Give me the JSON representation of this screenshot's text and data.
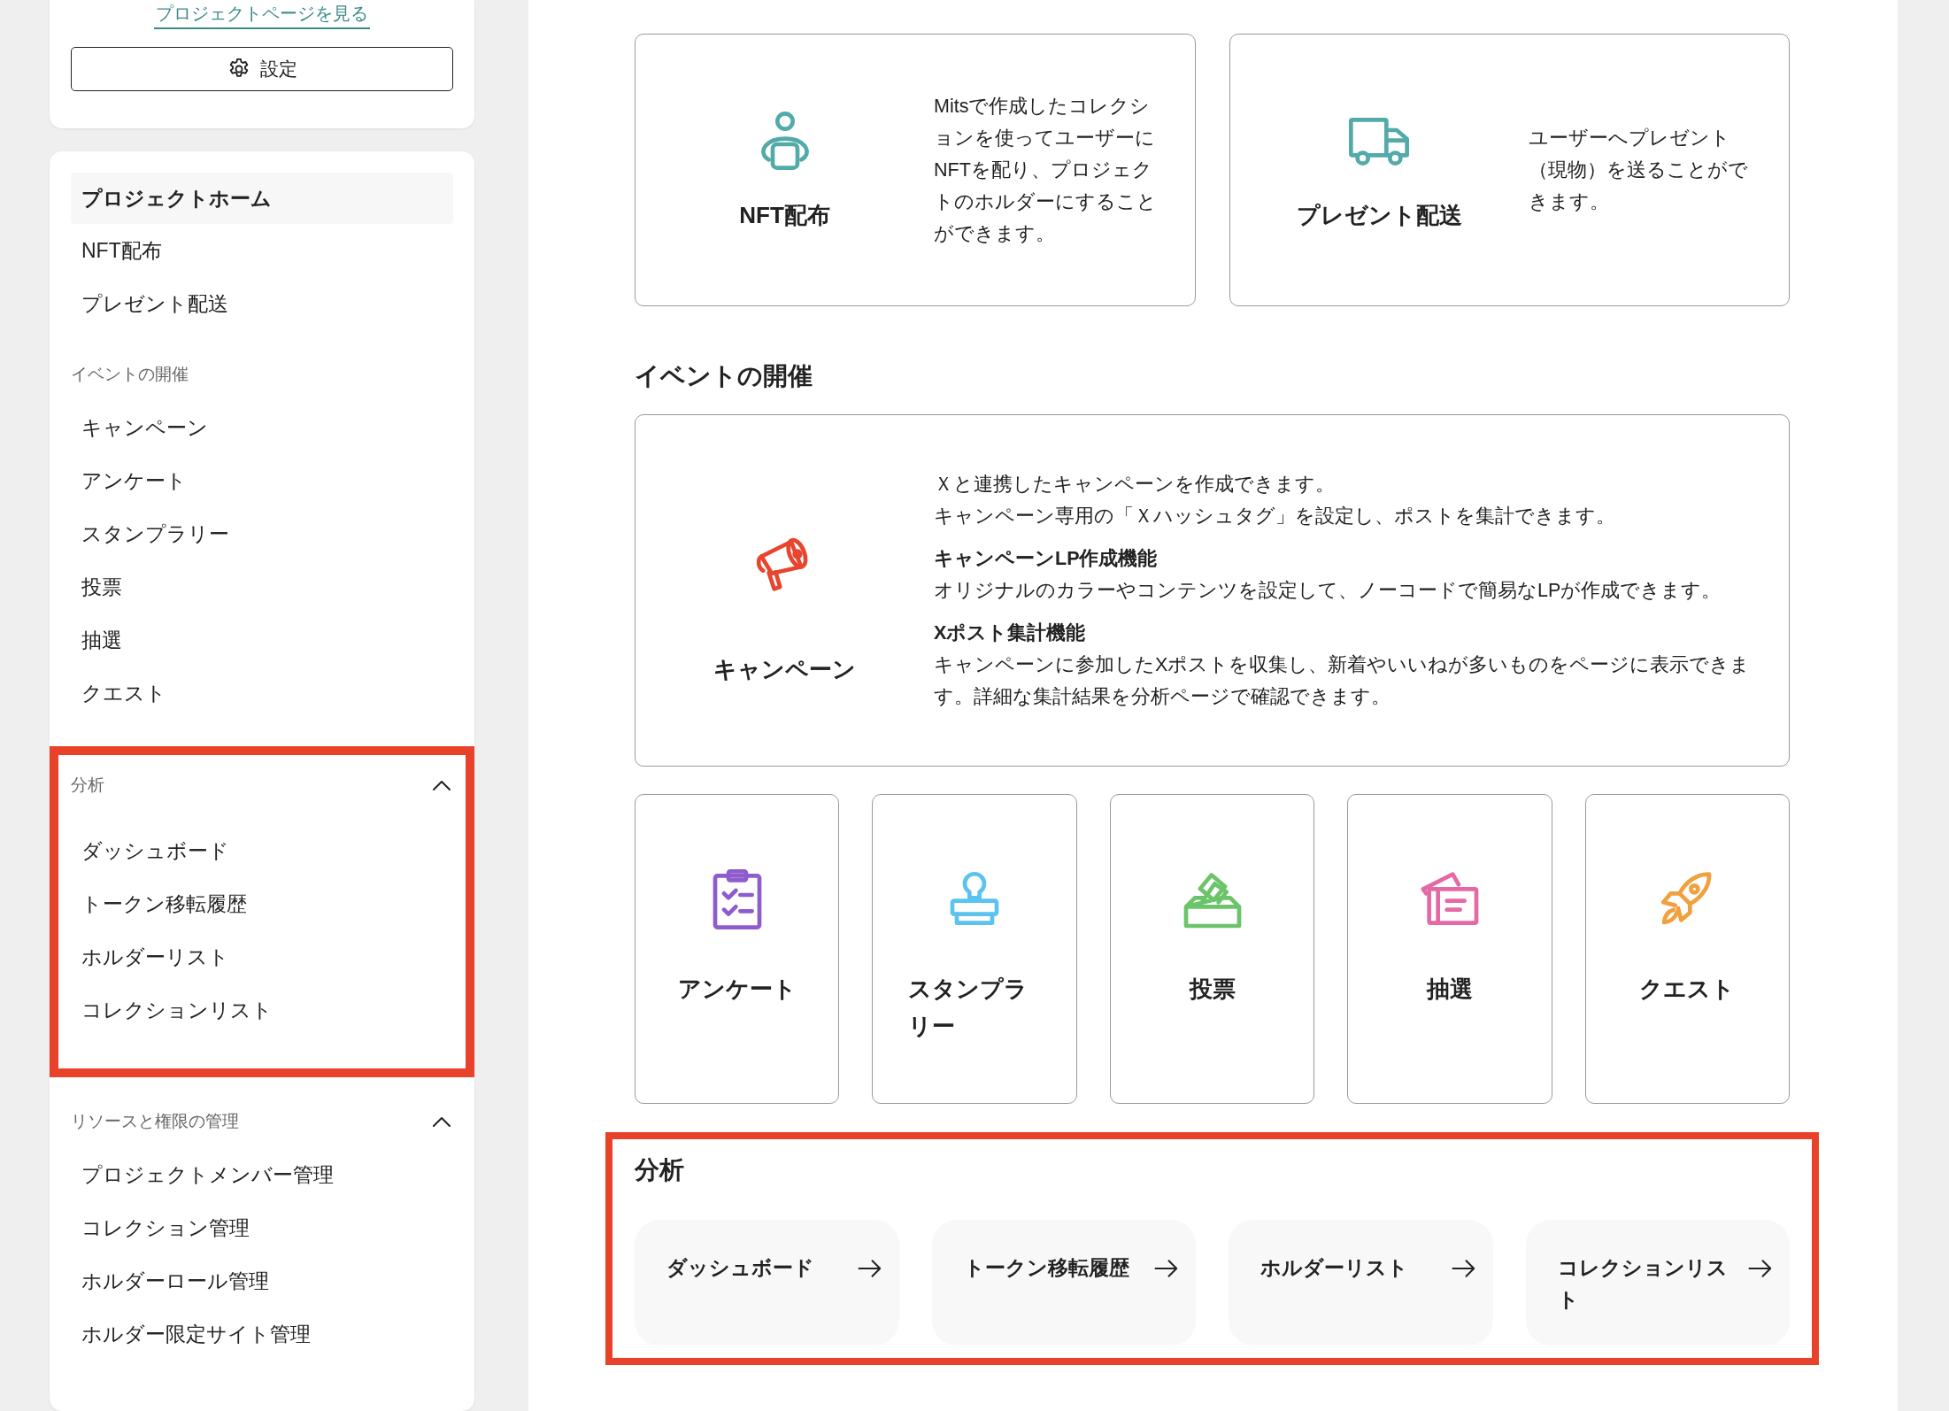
{
  "sidebar": {
    "project_link": "プロジェクトページを見る",
    "settings_button": "設定",
    "nav_items": [
      {
        "label": "プロジェクトホーム",
        "selected": true
      },
      {
        "label": "NFT配布",
        "selected": false
      },
      {
        "label": "プレゼント配送",
        "selected": false
      }
    ],
    "sections": [
      {
        "kind": "static",
        "title": "イベントの開催",
        "highlighted": false,
        "items": [
          {
            "label": "キャンペーン",
            "selected": false
          },
          {
            "label": "アンケート",
            "selected": false
          },
          {
            "label": "スタンプラリー",
            "selected": false
          },
          {
            "label": "投票",
            "selected": false
          },
          {
            "label": "抽選",
            "selected": false
          },
          {
            "label": "クエスト",
            "selected": false
          }
        ]
      },
      {
        "kind": "collapsible",
        "title": "分析",
        "expanded": true,
        "highlighted": true,
        "items": [
          {
            "label": "ダッシュボード",
            "selected": false
          },
          {
            "label": "トークン移転履歴",
            "selected": false
          },
          {
            "label": "ホルダーリスト",
            "selected": false
          },
          {
            "label": "コレクションリスト",
            "selected": false
          }
        ]
      },
      {
        "kind": "collapsible",
        "title": "リソースと権限の管理",
        "expanded": true,
        "highlighted": false,
        "items": [
          {
            "label": "プロジェクトメンバー管理",
            "selected": false
          },
          {
            "label": "コレクション管理",
            "selected": false
          },
          {
            "label": "ホルダーロール管理",
            "selected": false
          },
          {
            "label": "ホルダー限定サイト管理",
            "selected": false
          }
        ]
      }
    ]
  },
  "main": {
    "service_cards": [
      {
        "title": "NFT配布",
        "description": "Mitsで作成したコレクションを使ってユーザーにNFTを配り、プロジェクトのホルダーにすることができます。"
      },
      {
        "title": "プレゼント配送",
        "description": "ユーザーへプレゼント（現物）を送ることができます。"
      }
    ],
    "events": {
      "heading": "イベントの開催",
      "campaign": {
        "title": "キャンペーン",
        "intro": [
          "Ｘと連携したキャンペーンを作成できます。",
          "キャンペーン専用の「Ｘハッシュタグ」を設定し、ポストを集計できます。"
        ],
        "features": [
          {
            "title": "キャンペーンLP作成機能",
            "text": "オリジナルのカラーやコンテンツを設定して、ノーコードで簡易なLPが作成できます。"
          },
          {
            "title": "Xポスト集計機能",
            "text": "キャンペーンに参加したXポストを収集し、新着やいいねが多いものをページに表示できます。詳細な集計結果を分析ページで確認できます。"
          }
        ]
      },
      "cards": [
        {
          "title": "アンケート",
          "color": "#8e5ccc"
        },
        {
          "title": "スタンプラリー",
          "color": "#5bc3f0"
        },
        {
          "title": "投票",
          "color": "#6cc46a"
        },
        {
          "title": "抽選",
          "color": "#e46aa6"
        },
        {
          "title": "クエスト",
          "color": "#f0a03c"
        }
      ]
    },
    "analysis": {
      "heading": "分析",
      "highlighted": true,
      "links": [
        {
          "label": "ダッシュボード"
        },
        {
          "label": "トークン移転履歴"
        },
        {
          "label": "ホルダーリスト"
        },
        {
          "label": "コレクションリスト"
        }
      ]
    }
  }
}
